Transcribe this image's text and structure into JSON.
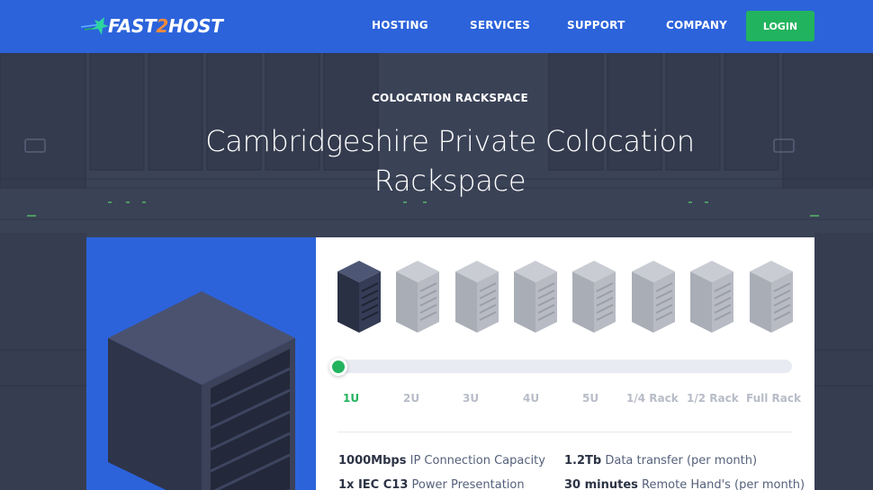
{
  "brand": {
    "logo_part1": "FAST",
    "logo_part2": "2",
    "logo_part3": "HOST",
    "accent": "#f28b3c"
  },
  "nav": {
    "items": [
      "HOSTING",
      "SERVICES",
      "SUPPORT",
      "COMPANY"
    ],
    "login_label": "LOGIN"
  },
  "hero": {
    "eyebrow": "COLOCATION RACKSPACE",
    "title": "Cambridgeshire Private Colocation Rackspace"
  },
  "selector": {
    "options": [
      "1U",
      "2U",
      "3U",
      "4U",
      "5U",
      "1/4 Rack",
      "1/2 Rack",
      "Full Rack"
    ],
    "selected_index": 0
  },
  "specs": [
    {
      "value": "1000Mbps",
      "label": "IP Connection Capacity"
    },
    {
      "value": "1.2Tb",
      "label": "Data transfer (per month)"
    },
    {
      "value": "1x IEC C13",
      "label": "Power Presentation"
    },
    {
      "value": "30 minutes",
      "label": "Remote Hand's (per month)"
    }
  ],
  "colors": {
    "brand_blue": "#2c63db",
    "success_green": "#22b35e",
    "hero_dark": "#394055"
  }
}
